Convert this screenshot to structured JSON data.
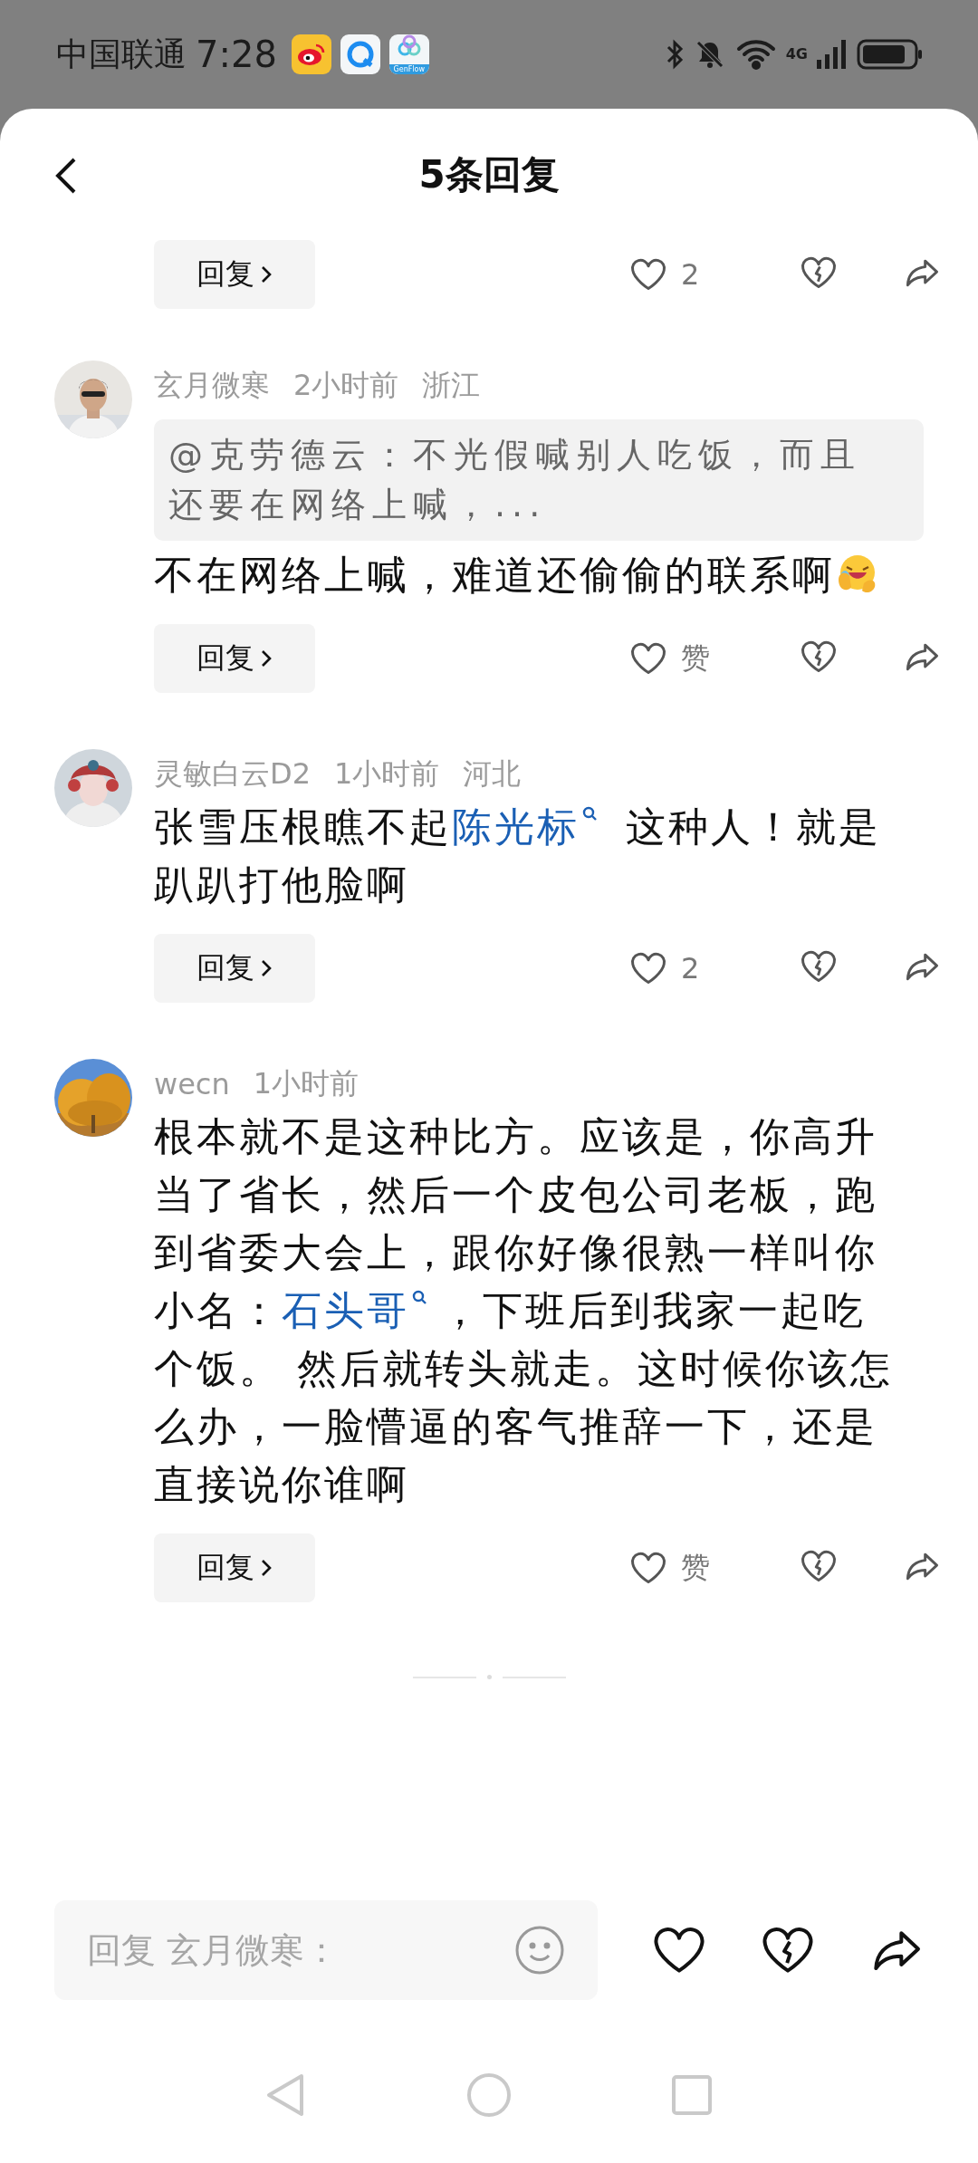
{
  "status_bar": {
    "carrier": "中国联通",
    "time": "7:28",
    "app_icons": [
      {
        "kind": "weibo"
      },
      {
        "kind": "browser"
      },
      {
        "kind": "genflow",
        "label": "GenFlow"
      }
    ],
    "network": "4G"
  },
  "header": {
    "title": "5条回复"
  },
  "top_actions": {
    "reply": "回复",
    "likes": "2"
  },
  "comments": [
    {
      "user": "玄月微寒",
      "time": "2小时前",
      "location": "浙江",
      "quote": "@克劳德云：不光假喊别人吃饭，而且还要在网络上喊，...",
      "body": [
        {
          "kind": "text",
          "text": "不在网络上喊，难道还偷偷的联系啊"
        },
        {
          "kind": "emoji"
        }
      ],
      "reply": "回复",
      "likes": "赞"
    },
    {
      "user": "灵敏白云D2",
      "time": "1小时前",
      "location": "河北",
      "body": [
        {
          "kind": "text",
          "text": "张雪压根瞧不起"
        },
        {
          "kind": "link",
          "text": "陈光标"
        },
        {
          "kind": "text",
          "text": " 这种人！就是趴趴打他脸啊"
        }
      ],
      "reply": "回复",
      "likes": "2"
    },
    {
      "user": "wecn",
      "time": "1小时前",
      "body": [
        {
          "kind": "text",
          "text": "根本就不是这种比方。应该是，你高升当了省长，然后一个皮包公司老板，跑到省委大会上，跟你好像很熟一样叫你小名："
        },
        {
          "kind": "link",
          "text": "石头哥"
        },
        {
          "kind": "text",
          "text": "，下班后到我家一起吃个饭。 然后就转头就走。这时候你该怎么办，一脸懵逼的客气推辞一下，还是直接说你谁啊"
        }
      ],
      "reply": "回复",
      "likes": "赞"
    }
  ],
  "reply_bar": {
    "placeholder": "回复 玄月微寒："
  }
}
